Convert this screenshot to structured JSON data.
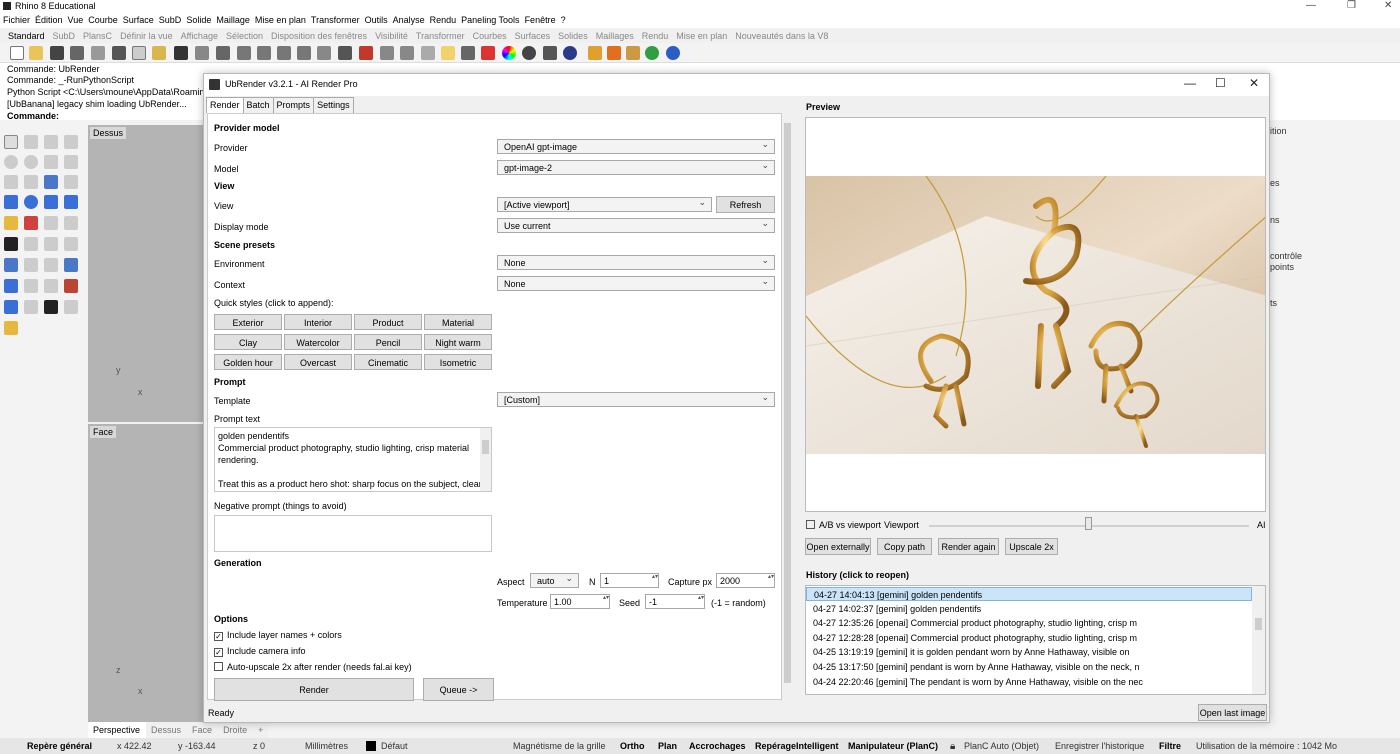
{
  "app": {
    "title": "Rhino 8 Educational",
    "menu": [
      "Fichier",
      "Édition",
      "Vue",
      "Courbe",
      "Surface",
      "SubD",
      "Solide",
      "Maillage",
      "Mise en plan",
      "Transformer",
      "Outils",
      "Analyse",
      "Rendu",
      "Paneling Tools",
      "Fenêtre",
      "?"
    ],
    "toolbar_tabs": [
      "Standard",
      "SubD",
      "PlansC",
      "Définir la vue",
      "Affichage",
      "Sélection",
      "Disposition des fenêtres",
      "Visibilité",
      "Transformer",
      "Courbes",
      "Surfaces",
      "Solides",
      "Maillages",
      "Rendu",
      "Mise en plan",
      "Nouveautés dans la V8"
    ],
    "command_history": [
      "Commande: UbRender",
      "Commande: _-RunPythonScript",
      "Python Script <C:\\Users\\moune\\AppData\\Roaming",
      "[UbBanana] legacy shim loading UbRender..."
    ],
    "command_prompt": "Commande:",
    "viewports": {
      "top": "Dessus",
      "front": "Face"
    },
    "axis": {
      "x": "x",
      "y": "y",
      "z": "z"
    },
    "right_panel": [
      "ition",
      "es",
      "ns",
      "contrôle",
      "points",
      "ts"
    ],
    "viewport_tabs": [
      "Perspective",
      "Dessus",
      "Face",
      "Droite",
      "+"
    ],
    "status_bar": {
      "cplane": "Repère général",
      "x": "x 422.42",
      "y": "y -163.44",
      "z": "z 0",
      "units": "Millimètres",
      "layer": "Défaut",
      "grid_snap": "Magnétisme de la grille",
      "ortho": "Ortho",
      "plan": "Plan",
      "osnap": "Accrochages",
      "smarttrack": "RepérageIntelligent",
      "gumball": "Manipulateur (PlanC)",
      "autocplane": "PlanC Auto (Objet)",
      "record_history": "Enregistrer l'historique",
      "filter": "Filtre",
      "memory": "Utilisation de la mémoire : 1042 Mo"
    }
  },
  "dialog": {
    "title": "UbRender v3.2.1 - AI Render Pro",
    "tabs": [
      "Render",
      "Batch",
      "Prompts",
      "Settings"
    ],
    "provider_section": "Provider  model",
    "provider_label": "Provider",
    "provider_value": "OpenAI gpt-image",
    "model_label": "Model",
    "model_value": "gpt-image-2",
    "view_section": "View",
    "view_label": "View",
    "view_value": "[Active viewport]",
    "refresh": "Refresh",
    "display_mode_label": "Display mode",
    "display_mode_value": "Use current",
    "scene_section": "Scene presets",
    "environment_label": "Environment",
    "environment_value": "None",
    "context_label": "Context",
    "context_value": "None",
    "quick_styles_label": "Quick styles (click to append):",
    "quick_styles": [
      "Exterior",
      "Interior",
      "Product",
      "Material",
      "Clay",
      "Watercolor",
      "Pencil",
      "Night warm",
      "Golden hour",
      "Overcast",
      "Cinematic",
      "Isometric"
    ],
    "prompt_section": "Prompt",
    "template_label": "Template",
    "template_value": "[Custom]",
    "prompt_text_label": "Prompt text",
    "prompt_lines": [
      "golden pendentifs",
      "Commercial product photography, studio lighting, crisp material",
      "rendering.",
      "",
      "Treat this as a product hero shot: sharp focus on the subject, clean"
    ],
    "negative_label": "Negative prompt (things to avoid)",
    "generation_section": "Generation",
    "aspect_label": "Aspect",
    "aspect_value": "auto",
    "n_label": "N",
    "n_value": "1",
    "capture_label": "Capture px",
    "capture_value": "2000",
    "temperature_label": "Temperature",
    "temperature_value": "1.00",
    "seed_label": "Seed",
    "seed_value": "-1",
    "seed_hint": "(-1 = random)",
    "options_section": "Options",
    "opt_layers": "Include layer names + colors",
    "opt_camera": "Include camera info",
    "opt_upscale": "Auto-upscale 2x after render (needs fal.ai key)",
    "check_mark": "✓",
    "render_btn": "Render",
    "queue_btn": "Queue ->",
    "preview_label": "Preview",
    "ab_label": "A/B vs viewport",
    "viewport_label": "Viewport",
    "ai_label": "AI",
    "slider_level": 0.5,
    "open_externally": "Open externally",
    "copy_path": "Copy path",
    "render_again": "Render again",
    "upscale": "Upscale 2x",
    "history_label": "History (click to reopen)",
    "history": [
      "04-27 14:04:13  [gemini] golden pendentifs",
      "04-27 14:02:37  [gemini] golden pendentifs",
      "04-27 12:35:26  [openai] Commercial product photography, studio lighting, crisp m",
      "04-27 12:28:28  [openai] Commercial product photography, studio lighting, crisp m",
      "04-25 13:19:19  [gemini] it is golden pendant   worn by Anne Hathaway, visible on",
      "04-25 13:17:50  [gemini] pendant is worn by Anne Hathaway, visible on the neck, n",
      "04-24 22:20:46  [gemini] The pendant is worn by Anne Hathaway, visible on the nec"
    ],
    "status": "Ready",
    "open_last_image": "Open last image"
  }
}
